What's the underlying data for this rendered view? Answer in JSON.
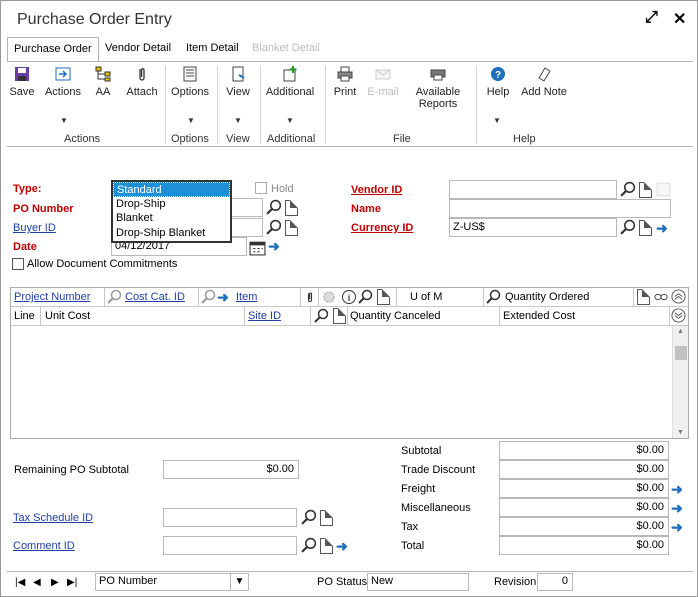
{
  "window": {
    "title": "Purchase Order Entry"
  },
  "tabs": [
    {
      "label": "Purchase Order"
    },
    {
      "label": "Vendor Detail"
    },
    {
      "label": "Item Detail"
    },
    {
      "label": "Blanket Detail"
    }
  ],
  "ribbon": {
    "save": "Save",
    "actions": "Actions",
    "aa": "AA",
    "attach": "Attach",
    "options": "Options",
    "view": "View",
    "additional": "Additional",
    "print": "Print",
    "email": "E-mail",
    "available": "Available",
    "reports": "Reports",
    "help": "Help",
    "add_note": "Add Note",
    "groups": {
      "actions": "Actions",
      "options": "Options",
      "view": "View",
      "additional": "Additional",
      "file": "File",
      "help": "Help"
    }
  },
  "form": {
    "type_label": "Type:",
    "type_options": [
      "Standard",
      "Drop-Ship",
      "Blanket",
      "Drop-Ship Blanket"
    ],
    "hold_label": "Hold",
    "po_number_label": "PO Number",
    "buyer_id_label": "Buyer ID",
    "date_label": "Date",
    "date_value": "04/12/2017",
    "allow_commit_label": "Allow Document Commitments",
    "vendor_id_label": "Vendor ID",
    "name_label": "Name",
    "currency_id_label": "Currency ID",
    "currency_id_value": "Z-US$"
  },
  "grid": {
    "row1": {
      "project_number": "Project Number",
      "cost_cat_id": "Cost Cat. ID",
      "item": "Item",
      "u_of_m": "U of M",
      "quantity_ordered": "Quantity Ordered"
    },
    "row2": {
      "line": "Line",
      "unit_cost": "Unit Cost",
      "site_id": "Site ID",
      "quantity_canceled": "Quantity Canceled",
      "extended_cost": "Extended Cost"
    }
  },
  "totals": {
    "remaining_label": "Remaining PO Subtotal",
    "remaining_value": "$0.00",
    "tax_schedule_label": "Tax Schedule ID",
    "comment_label": "Comment ID",
    "subtotal_label": "Subtotal",
    "subtotal_value": "$0.00",
    "trade_discount_label": "Trade Discount",
    "trade_discount_value": "$0.00",
    "freight_label": "Freight",
    "freight_value": "$0.00",
    "misc_label": "Miscellaneous",
    "misc_value": "$0.00",
    "tax_label": "Tax",
    "tax_value": "$0.00",
    "total_label": "Total",
    "total_value": "$0.00"
  },
  "footer": {
    "sort_value": "PO Number",
    "po_status_label": "PO Status",
    "po_status_value": "New",
    "revision_label": "Revision",
    "revision_value": "0"
  },
  "colors": {
    "required": "#c00000",
    "link": "#1f3fa8",
    "selection": "#1e90d6",
    "arrow": "#1f6fbd"
  }
}
